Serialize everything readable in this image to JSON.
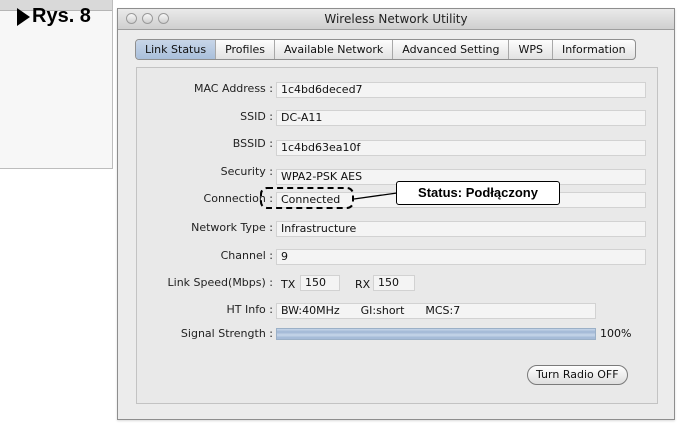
{
  "figure": {
    "label": "Rys. 8"
  },
  "window": {
    "title": "Wireless Network Utility"
  },
  "tabs": [
    {
      "label": "Link Status"
    },
    {
      "label": "Profiles"
    },
    {
      "label": "Available Network"
    },
    {
      "label": "Advanced Setting"
    },
    {
      "label": "WPS"
    },
    {
      "label": "Information"
    }
  ],
  "status": {
    "mac_label": "MAC Address :",
    "mac_value": "1c4bd6deced7",
    "ssid_label": "SSID :",
    "ssid_value": "DC-A11",
    "bssid_label": "BSSID :",
    "bssid_value": "1c4bd63ea10f",
    "security_label": "Security :",
    "security_value": "WPA2-PSK AES",
    "connection_label": "Connection :",
    "connection_value": "Connected",
    "network_type_label": "Network Type :",
    "network_type_value": "Infrastructure",
    "channel_label": "Channel :",
    "channel_value": "9",
    "link_speed_label": "Link Speed(Mbps) :",
    "tx_label": "TX",
    "tx_value": "150",
    "rx_label": "RX",
    "rx_value": "150",
    "ht_label": "HT Info :",
    "ht_bw": "BW:40MHz",
    "ht_gi": "GI:short",
    "ht_mcs": "MCS:7",
    "signal_label": "Signal Strength :",
    "signal_text": "100%",
    "signal_level": 1.0
  },
  "buttons": {
    "turn_radio_off": "Turn Radio OFF"
  },
  "annotation": {
    "callout": "Status: Podłączony"
  }
}
